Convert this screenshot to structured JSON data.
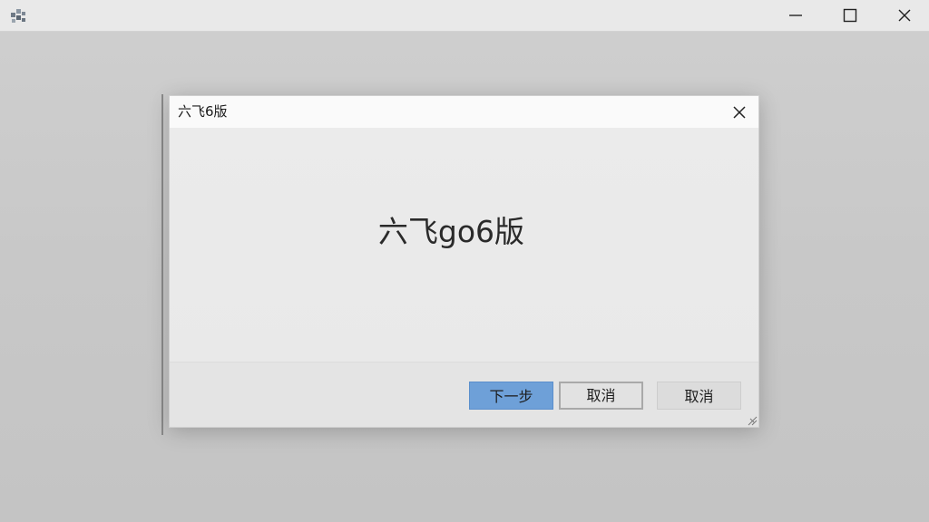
{
  "window": {
    "icon": "app-puzzle-icon",
    "controls": {
      "minimize": "minimize-icon",
      "maximize": "maximize-icon",
      "close": "close-icon"
    }
  },
  "dialog": {
    "title": "六飞6版",
    "headline": "六飞go6版",
    "close_icon": "close-icon",
    "buttons": {
      "next": "下一步",
      "cancel": "取消",
      "cancel_secondary": "取消"
    },
    "colors": {
      "primary_button": "#6ea0d8",
      "background": "#ededed"
    }
  }
}
